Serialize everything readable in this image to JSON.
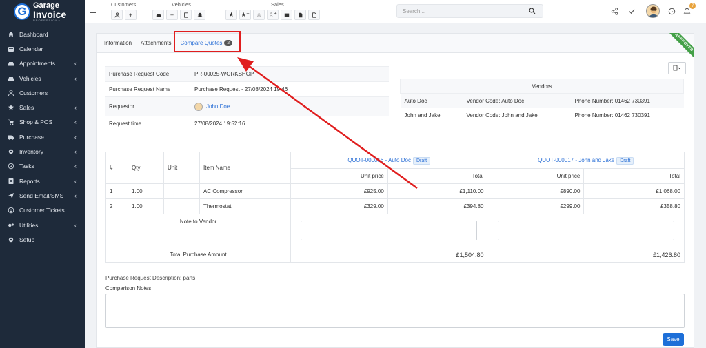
{
  "brand": {
    "line1": "Garage",
    "line2": "Invoice",
    "line3": "PROFESSIONAL",
    "letter": "G"
  },
  "sidebar": {
    "items": [
      {
        "label": "Dashboard",
        "icon": "home-icon",
        "chevron": false
      },
      {
        "label": "Calendar",
        "icon": "calendar-icon",
        "chevron": false
      },
      {
        "label": "Appointments",
        "icon": "car-icon",
        "chevron": true
      },
      {
        "label": "Vehicles",
        "icon": "car-icon",
        "chevron": true
      },
      {
        "label": "Customers",
        "icon": "user-icon",
        "chevron": false
      },
      {
        "label": "Sales",
        "icon": "star-icon",
        "chevron": true
      },
      {
        "label": "Shop & POS",
        "icon": "cart-icon",
        "chevron": true
      },
      {
        "label": "Purchase",
        "icon": "truck-icon",
        "chevron": true
      },
      {
        "label": "Inventory",
        "icon": "gear-icon",
        "chevron": true
      },
      {
        "label": "Tasks",
        "icon": "check-circle-icon",
        "chevron": true
      },
      {
        "label": "Reports",
        "icon": "report-icon",
        "chevron": true
      },
      {
        "label": "Send Email/SMS",
        "icon": "mail-icon",
        "chevron": true
      },
      {
        "label": "Customer Tickets",
        "icon": "ticket-icon",
        "chevron": false
      },
      {
        "label": "Utilities",
        "icon": "tools-icon",
        "chevron": true
      },
      {
        "label": "Setup",
        "icon": "gear-icon",
        "chevron": false
      }
    ]
  },
  "topbar": {
    "groups": {
      "customers": "Customers",
      "vehicles": "Vehicles",
      "sales": "Sales"
    },
    "search_placeholder": "Search...",
    "notification_count": "7"
  },
  "tabs": {
    "information": "Information",
    "attachments": "Attachments",
    "compare": "Compare Quotes",
    "compare_count": "2"
  },
  "ribbon": "APPROVED",
  "request": {
    "rows": [
      {
        "key": "Purchase Request Code",
        "value": "PR-00025-WORKSHOP"
      },
      {
        "key": "Purchase Request Name",
        "value": "Purchase Request - 27/08/2024 19:46"
      },
      {
        "key": "Requestor",
        "value": "John Doe"
      },
      {
        "key": "Request time",
        "value": "27/08/2024 19:52:16"
      }
    ]
  },
  "vendors": {
    "title": "Vendors",
    "rows": [
      {
        "name": "Auto Doc",
        "code": "Vendor Code: Auto Doc",
        "phone": "Phone Number: 01462 730391"
      },
      {
        "name": "John and Jake",
        "code": "Vendor Code: John and Jake",
        "phone": "Phone Number: 01462 730391"
      }
    ]
  },
  "quotes": {
    "headers": {
      "num": "#",
      "qty": "Qty",
      "unit": "Unit",
      "item": "Item Name",
      "unit_price": "Unit price",
      "total": "Total"
    },
    "quote1": {
      "code": "QUOT-000016 - Auto Doc",
      "status": "Draft"
    },
    "quote2": {
      "code": "QUOT-000017 - John and Jake",
      "status": "Draft"
    },
    "items": [
      {
        "num": "1",
        "qty": "1.00",
        "unit": "",
        "name": "AC Compressor",
        "q1_price": "£925.00",
        "q1_total": "£1,110.00",
        "q2_price": "£890.00",
        "q2_total": "£1,068.00"
      },
      {
        "num": "2",
        "qty": "1.00",
        "unit": "",
        "name": "Thermostat",
        "q1_price": "£329.00",
        "q1_total": "£394.80",
        "q2_price": "£299.00",
        "q2_total": "£358.80"
      }
    ],
    "note_label": "Note to Vendor",
    "total_label": "Total Purchase Amount",
    "q1_grand": "£1,504.80",
    "q2_grand": "£1,426.80"
  },
  "description": {
    "label": "Purchase Request Description:",
    "value": "parts"
  },
  "comparison_notes_label": "Comparison Notes",
  "save_label": "Save",
  "colors": {
    "accent": "#1d6fd8",
    "sidebar": "#1e2a3a",
    "highlight": "#e01e1e",
    "approved": "#43a047"
  }
}
